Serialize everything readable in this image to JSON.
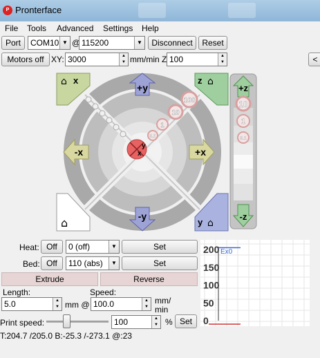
{
  "window": {
    "title": "Pronterface",
    "icon_text": "P"
  },
  "menu": [
    "File",
    "Tools",
    "Advanced",
    "Settings",
    "Help"
  ],
  "connection": {
    "port_label": "Port",
    "port_value": "COM10",
    "at": "@",
    "baud_value": "115200",
    "disconnect_label": "Disconnect",
    "reset_label": "Reset"
  },
  "row2": {
    "motors_off_label": "Motors off",
    "xy_label": "XY:",
    "xy_value": "3000",
    "z_label": "mm/min Z:",
    "z_value": "100",
    "side_arrow": "<"
  },
  "jog": {
    "home_x": "x",
    "home_y": "y",
    "home_z": "z",
    "plus_y": "+y",
    "minus_y": "-y",
    "plus_x": "+x",
    "minus_x": "-x",
    "steps": [
      "100",
      "10",
      "1",
      "0.1"
    ],
    "center_y": "y",
    "center_x": "x",
    "z_plus": "+z",
    "z_minus": "-z",
    "z_steps": [
      "10",
      "1",
      "0.1"
    ]
  },
  "temps": {
    "heat_label": "Heat:",
    "heat_off": "Off",
    "heat_value": "0 (off)",
    "heat_set": "Set",
    "bed_label": "Bed:",
    "bed_off": "Off",
    "bed_value": "110 (abs)",
    "bed_set": "Set"
  },
  "extrude": {
    "extrude_label": "Extrude",
    "reverse_label": "Reverse",
    "length_label": "Length:",
    "length_value": "5.0",
    "mm_at": "mm @",
    "speed_label": "Speed:",
    "speed_value": "100.0",
    "mm_min_1": "mm/",
    "mm_min_2": "min"
  },
  "print_speed": {
    "label": "Print speed:",
    "value": "100",
    "pct": "%",
    "set_label": "Set",
    "slider_fraction": 0.3
  },
  "status": {
    "temps": "T:204.7 /205.0 B:-25.3 /-273.1 @:23"
  },
  "chart_data": {
    "type": "line",
    "y_ticks": [
      "200",
      "150",
      "100",
      "50",
      "0"
    ],
    "ylim": [
      0,
      200
    ],
    "series": [
      {
        "name": "Ex0",
        "values": [
          205,
          205
        ]
      }
    ],
    "grid": true,
    "colors": {
      "ex0": "#3a6bd1",
      "bed": "#d03030",
      "axis": "#333333"
    }
  }
}
